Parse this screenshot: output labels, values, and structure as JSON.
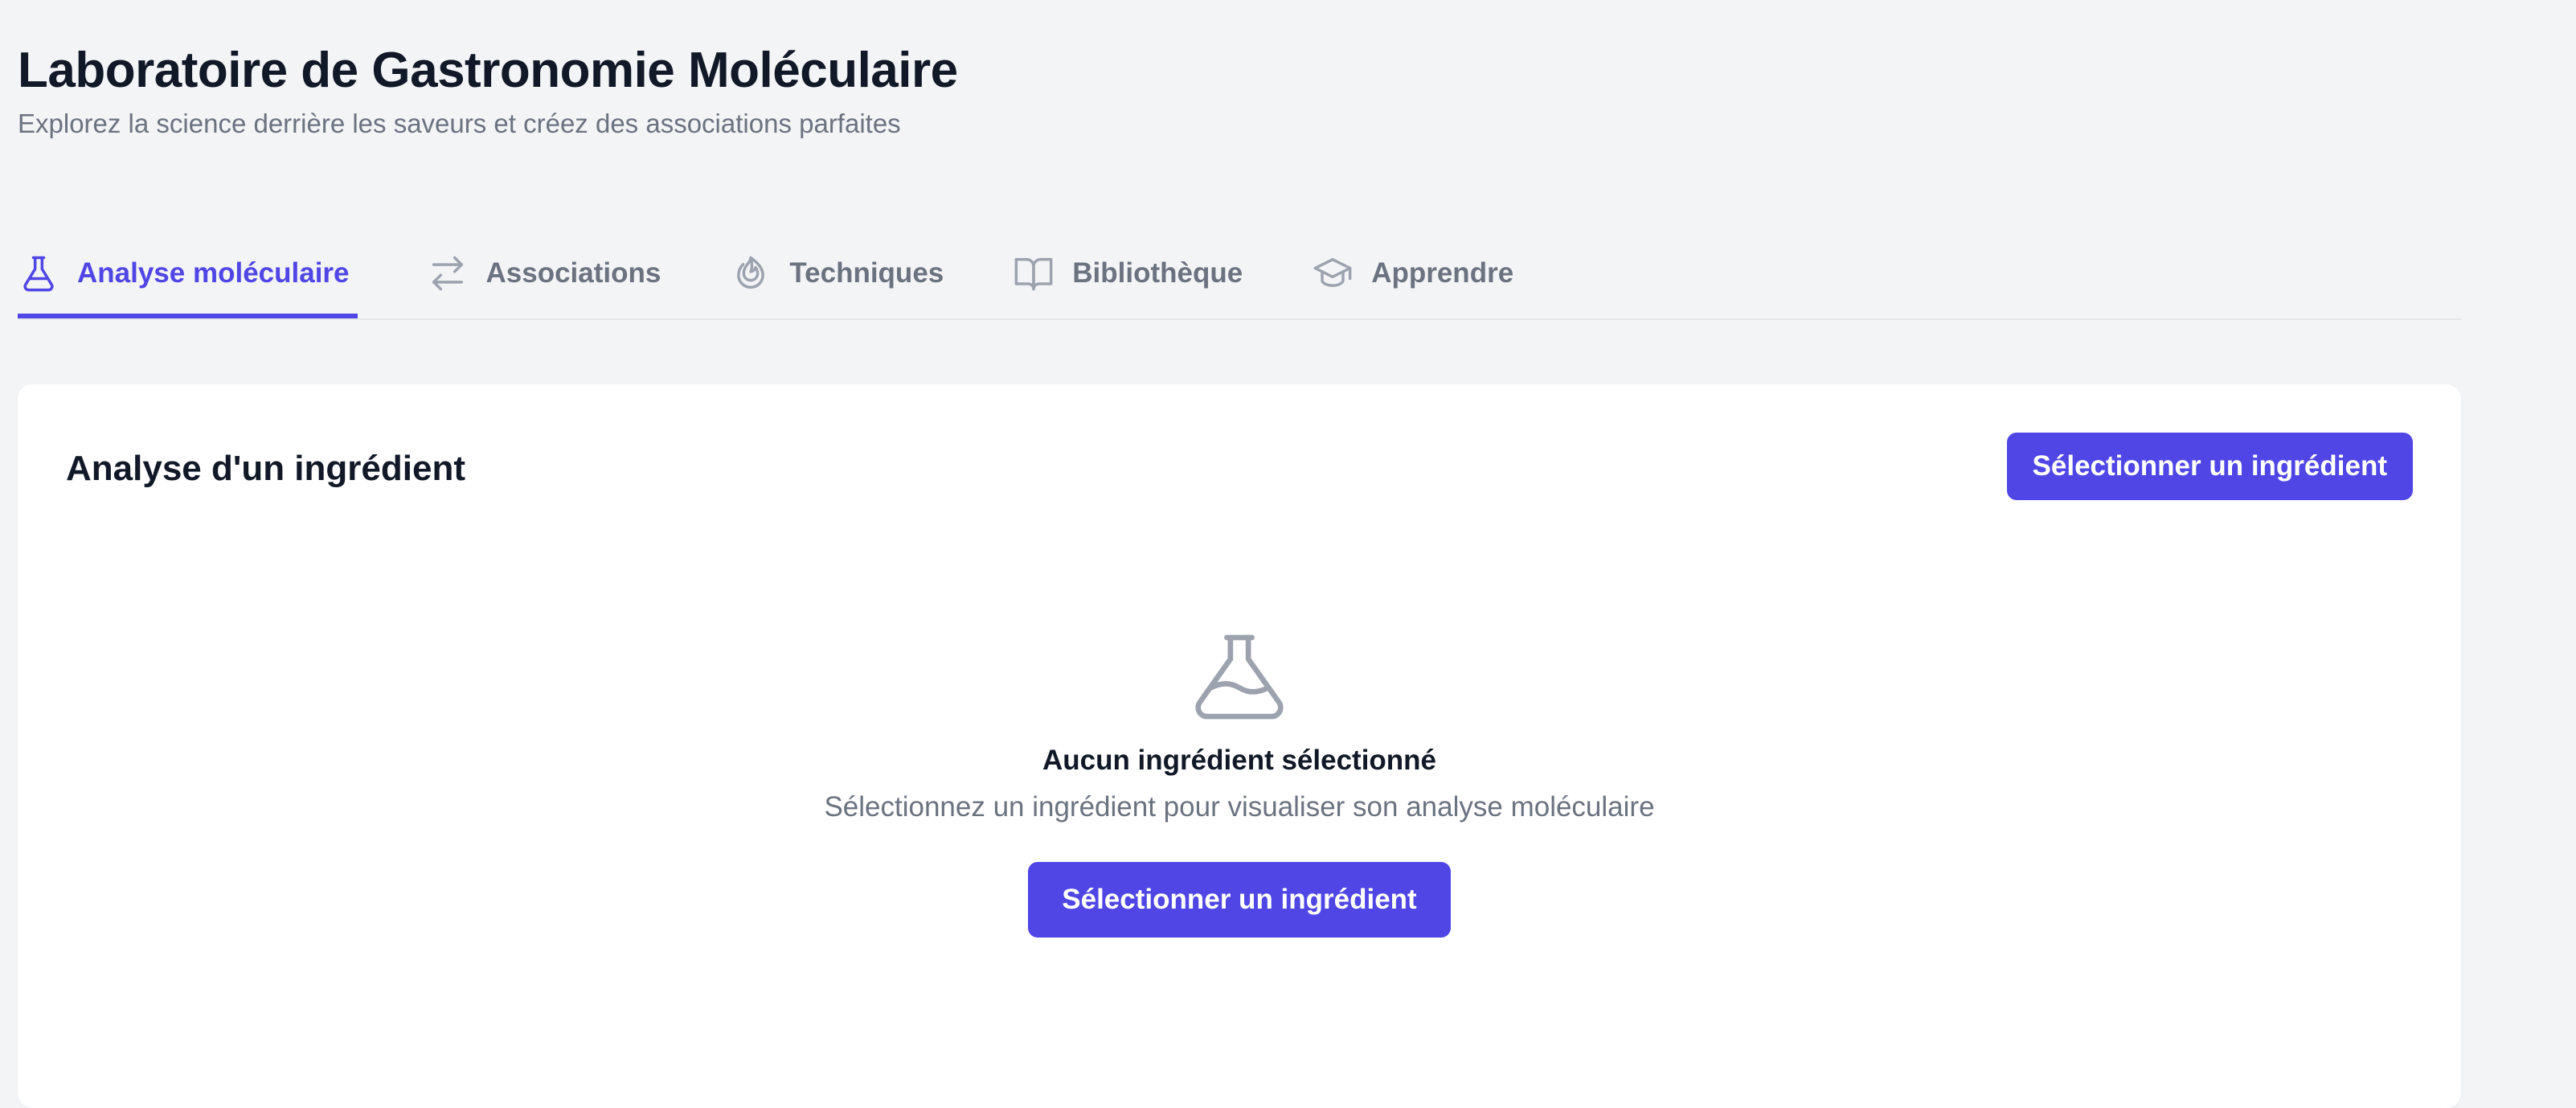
{
  "header": {
    "title": "Laboratoire de Gastronomie Moléculaire",
    "subtitle": "Explorez la science derrière les saveurs et créez des associations parfaites"
  },
  "tabs": [
    {
      "label": "Analyse moléculaire",
      "icon": "flask-icon",
      "active": true
    },
    {
      "label": "Associations",
      "icon": "arrows-exchange-icon",
      "active": false
    },
    {
      "label": "Techniques",
      "icon": "flame-icon",
      "active": false
    },
    {
      "label": "Bibliothèque",
      "icon": "book-open-icon",
      "active": false
    },
    {
      "label": "Apprendre",
      "icon": "graduation-cap-icon",
      "active": false
    }
  ],
  "panel": {
    "title": "Analyse d'un ingrédient",
    "select_button": "Sélectionner un ingrédient",
    "empty_state": {
      "icon": "flask-icon",
      "title": "Aucun ingrédient sélectionné",
      "description": "Sélectionnez un ingrédient pour visualiser son analyse moléculaire",
      "button": "Sélectionner un ingrédient"
    }
  },
  "colors": {
    "accent": "#4f46e5",
    "background": "#f3f4f6",
    "muted_text": "#6b7280",
    "icon_gray": "#9ca3af"
  }
}
